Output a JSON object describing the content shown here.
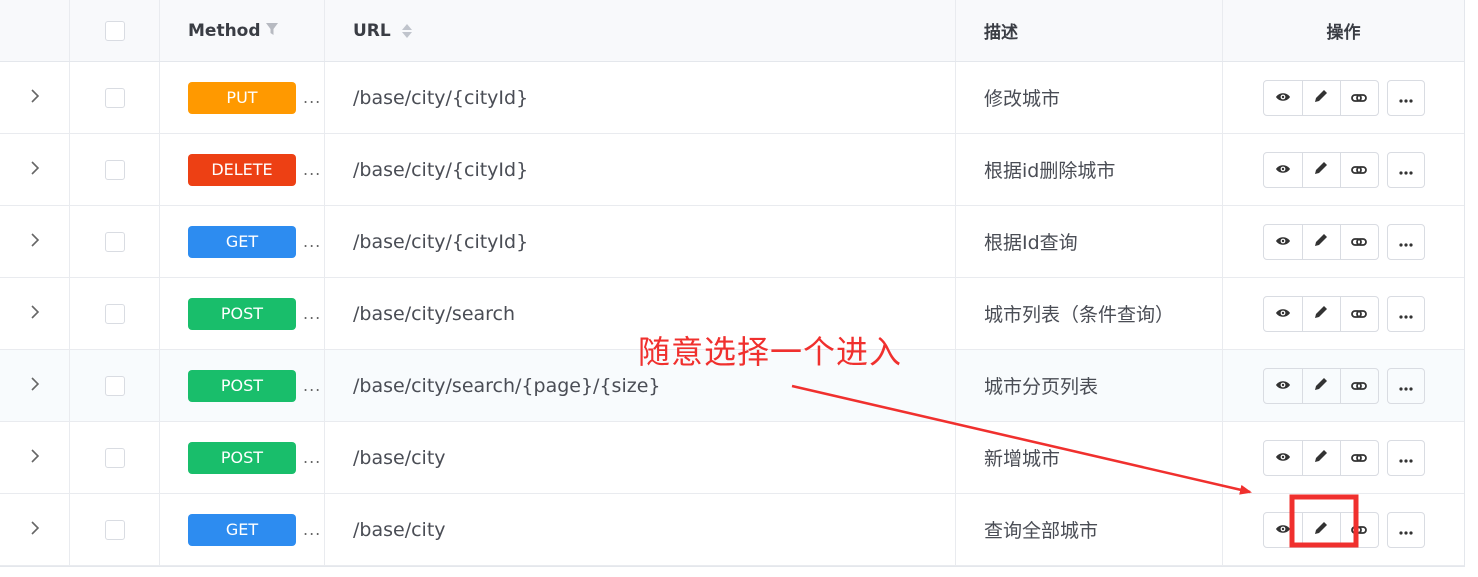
{
  "header": {
    "method": "Method",
    "url": "URL",
    "desc": "描述",
    "ops": "操作"
  },
  "colors": {
    "PUT": "#ff9900",
    "DELETE": "#ed4014",
    "GET": "#2d8cf0",
    "POST": "#19be6b",
    "annotation": "#f0302e"
  },
  "rows": [
    {
      "method": "PUT",
      "url": "/base/city/{cityId}",
      "desc": "修改城市"
    },
    {
      "method": "DELETE",
      "url": "/base/city/{cityId}",
      "desc": "根据id删除城市"
    },
    {
      "method": "GET",
      "url": "/base/city/{cityId}",
      "desc": "根据Id查询"
    },
    {
      "method": "POST",
      "url": "/base/city/search",
      "desc": "城市列表（条件查询）"
    },
    {
      "method": "POST",
      "url": "/base/city/search/{page}/{size}",
      "desc": "城市分页列表"
    },
    {
      "method": "POST",
      "url": "/base/city",
      "desc": "新增城市"
    },
    {
      "method": "GET",
      "url": "/base/city",
      "desc": "查询全部城市"
    }
  ],
  "row_icons": {
    "expand": "chevron-right-icon",
    "view": "eye-icon",
    "edit": "pencil-icon",
    "link": "link-icon",
    "more": "ellipsis-icon"
  },
  "truncation_marker": "...",
  "annotation": {
    "text": "随意选择一个进入"
  }
}
